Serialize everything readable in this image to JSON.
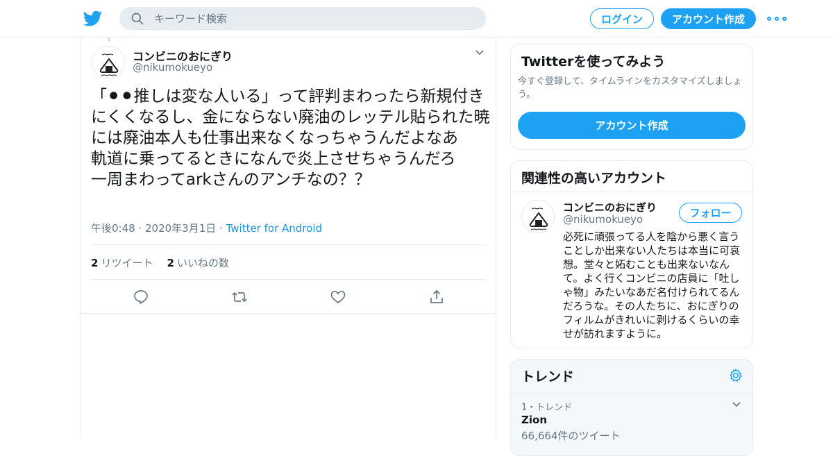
{
  "header": {
    "search_placeholder": "キーワード検索",
    "login_label": "ログイン",
    "signup_label": "アカウント作成"
  },
  "tweet": {
    "display_name": "コンビニのおにぎり",
    "handle": "@nikumokueyo",
    "text": "「⚫⚫推しは変な人いる」って評判まわったら新規付きにくくなるし、金にならない廃油のレッテル貼られた暁には廃油本人も仕事出来なくなっちゃうんだよなあ\n軌道に乗ってるときになんで炎上させちゃうんだろ\n一周まわってarkさんのアンチなの？？",
    "time": "午後0:48",
    "date": "2020年3月1日",
    "separator": " · ",
    "source": "Twitter for Android",
    "retweets_count": "2",
    "retweets_label": "リツイート",
    "likes_count": "2",
    "likes_label": "いいねの数"
  },
  "signup_card": {
    "title": "Twitterを使ってみよう",
    "description": "今すぐ登録して、タイムラインをカスタマイズしましょう。",
    "button_label": "アカウント作成"
  },
  "related_card": {
    "title": "関連性の高いアカウント",
    "account": {
      "display_name": "コンビニのおにぎり",
      "handle": "@nikumokueyo",
      "follow_label": "フォロー",
      "bio": "必死に頑張ってる人を陰から悪く言うことしか出来ない人たちは本当に可哀想。堂々と妬むことも出来ないなんて。よく行くコンビニの店員に「吐しゃ物」みたいなあだ名付けられてるんだろうな。その人たちに、おにぎりのフィルムがきれいに剥けるくらいの幸せが訪れますように。"
    }
  },
  "trends_card": {
    "title": "トレンド",
    "items": [
      {
        "rank": "1・トレンド",
        "name": "Zion",
        "count": "66,664件のツイート"
      }
    ]
  },
  "colors": {
    "accent": "#1da1f2",
    "link": "#1b95e0",
    "muted": "#657786",
    "border": "#e6ecf0"
  },
  "icons": [
    "twitter-logo-icon",
    "search-icon",
    "more-icon",
    "chevron-down-icon",
    "reply-icon",
    "retweet-icon",
    "like-icon",
    "share-icon",
    "gear-icon"
  ]
}
